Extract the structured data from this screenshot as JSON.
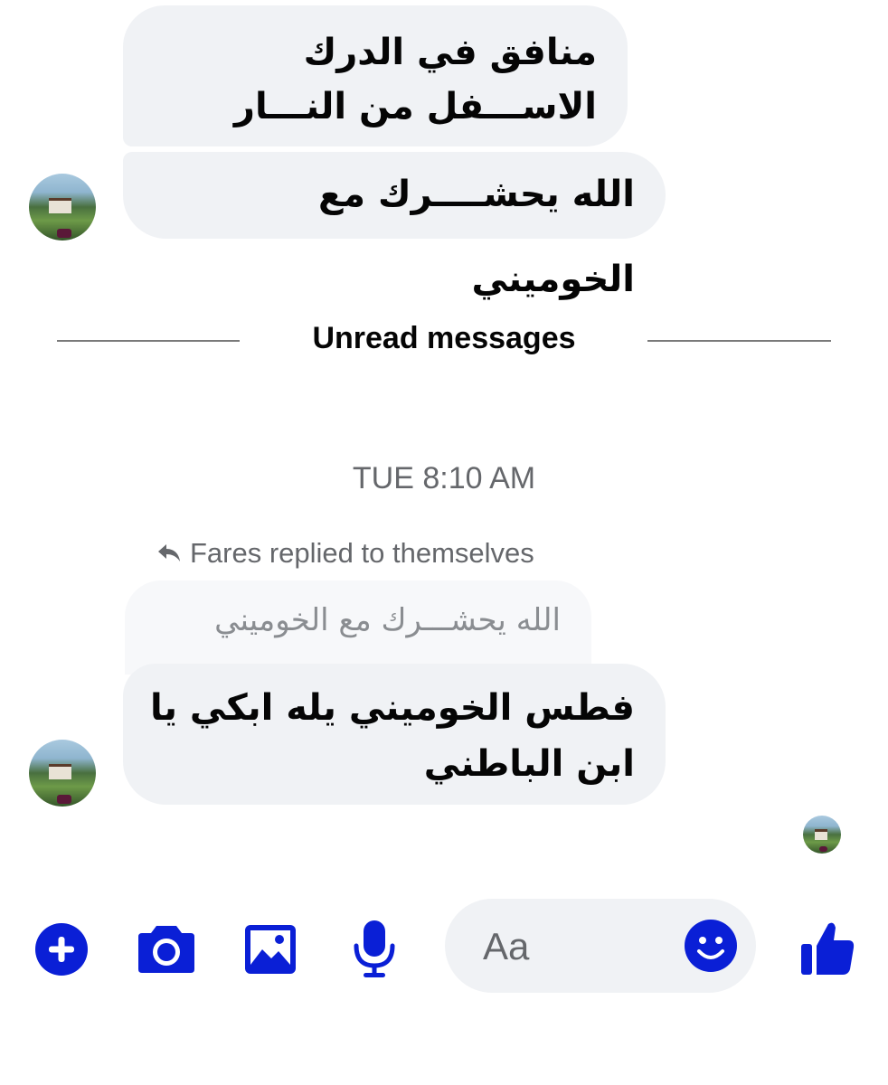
{
  "conversation": {
    "messages_top": [
      "منافق في الدرك الاســـفل من النـــار",
      "الله يحشــــرك مع الخوميني"
    ],
    "divider_label": "Unread messages",
    "timestamp": "TUE 8:10 AM",
    "reply": {
      "note": "Fares replied to themselves",
      "quoted_text": "الله يحشـــرك مع الخوميني",
      "message": "فطس الخوميني  يله ابكي يا ابن الباطني"
    }
  },
  "composer": {
    "placeholder": "Aa",
    "icons": [
      "plus-icon",
      "camera-icon",
      "image-icon",
      "microphone-icon",
      "emoji-icon",
      "thumbs-up-icon"
    ]
  },
  "colors": {
    "accent": "#0a1fd6",
    "bubble": "#f0f2f5",
    "muted_text": "#65676b"
  }
}
